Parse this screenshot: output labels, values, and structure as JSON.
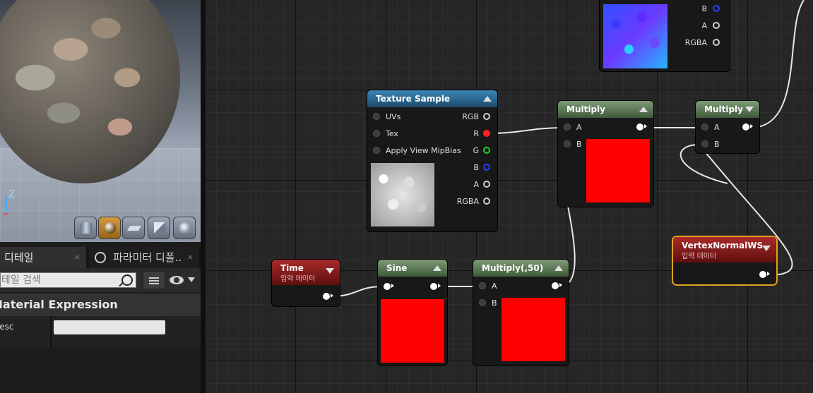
{
  "viewport": {
    "axis_label": "Z",
    "toolbar": [
      {
        "name": "cylinder-preview",
        "active": false
      },
      {
        "name": "sphere-preview",
        "active": true
      },
      {
        "name": "plane-preview",
        "active": false
      },
      {
        "name": "cube-preview",
        "active": false
      },
      {
        "name": "custom-mesh-preview",
        "active": false
      }
    ]
  },
  "details": {
    "tabs": [
      {
        "label": "디테일",
        "close": "×"
      },
      {
        "label": "파라미터 디폴..",
        "close": "×"
      }
    ],
    "search_placeholder": "디테일 검색",
    "section_title": "Material Expression",
    "property_label": "Desc",
    "property_value": ""
  },
  "graph": {
    "nodes": {
      "texture_sample_top": {
        "pins_out": [
          "B",
          "A",
          "RGBA"
        ]
      },
      "texture_sample": {
        "title": "Texture Sample",
        "pins_in": [
          "UVs",
          "Tex",
          "Apply View MipBias"
        ],
        "pins_out": [
          "RGB",
          "R",
          "G",
          "B",
          "A",
          "RGBA"
        ]
      },
      "multiply_1": {
        "title": "Multiply",
        "pins_in": [
          "A",
          "B"
        ]
      },
      "multiply_2": {
        "title": "Multiply",
        "pins_in": [
          "A",
          "B"
        ]
      },
      "time": {
        "title": "Time",
        "subtitle": "입력 데이터"
      },
      "sine": {
        "title": "Sine"
      },
      "multiply_50": {
        "title": "Multiply(,50)",
        "pins_in": [
          "A",
          "B"
        ]
      },
      "vertex_normal": {
        "title": "VertexNormalWS",
        "subtitle": "입력 데이터"
      }
    },
    "colors": {
      "graph_bg": "#262626",
      "green_header": "#5a7553",
      "blue_header": "#2c6a94",
      "red_header": "#8a1d1d",
      "selection": "#e0a020",
      "preview_red": "#ff0000"
    }
  }
}
